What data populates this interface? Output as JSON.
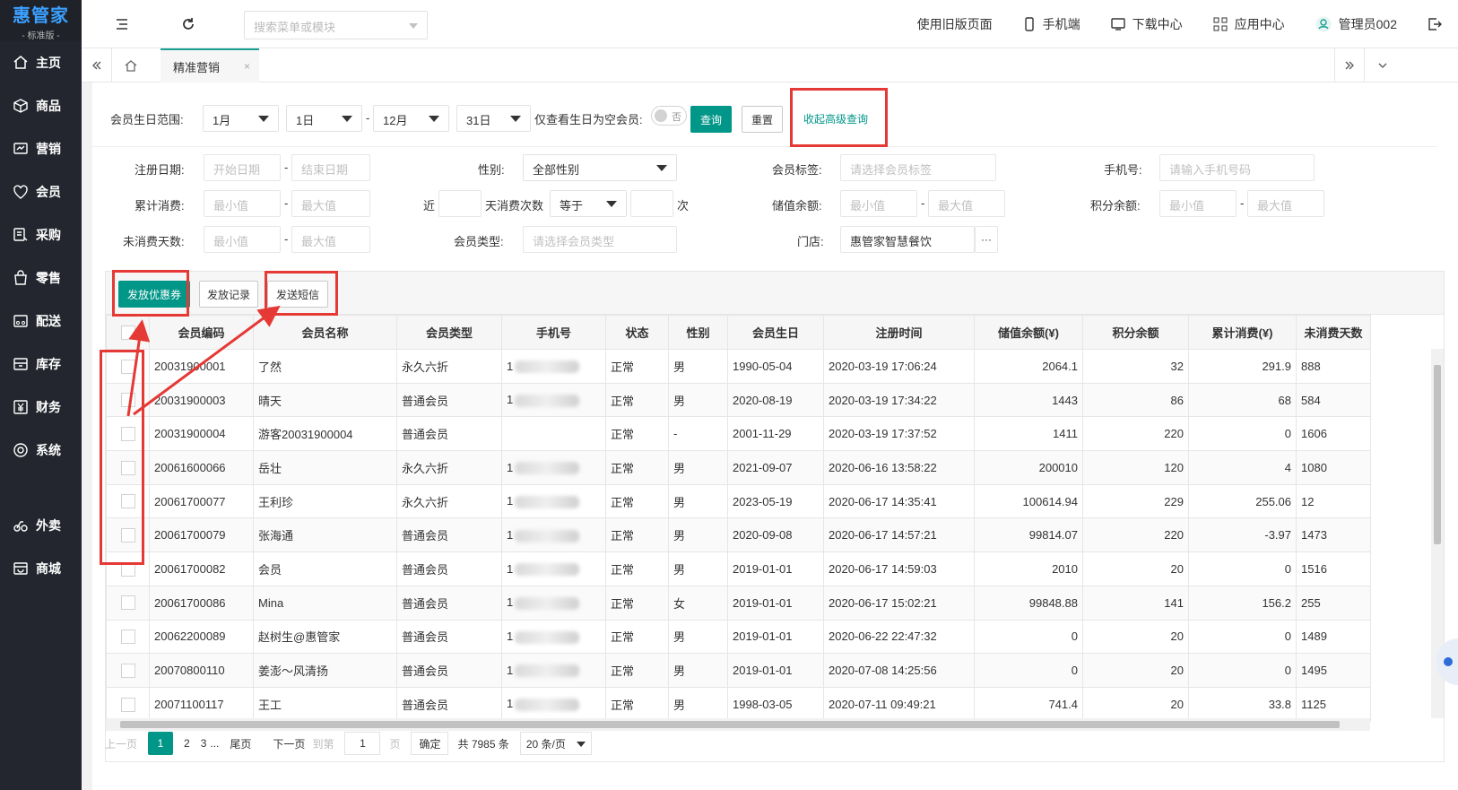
{
  "sidebar": {
    "logo": "惠管家",
    "logo_sub": "- 标准版 -",
    "items": [
      {
        "label": "主页",
        "icon": "home-icon"
      },
      {
        "label": "商品",
        "icon": "box-icon"
      },
      {
        "label": "营销",
        "icon": "marketing-icon"
      },
      {
        "label": "会员",
        "icon": "member-icon"
      },
      {
        "label": "采购",
        "icon": "purchase-icon"
      },
      {
        "label": "零售",
        "icon": "retail-icon"
      },
      {
        "label": "配送",
        "icon": "delivery-icon"
      },
      {
        "label": "库存",
        "icon": "inventory-icon"
      },
      {
        "label": "财务",
        "icon": "finance-icon"
      },
      {
        "label": "系统",
        "icon": "system-icon"
      },
      {
        "label": "外卖",
        "icon": "takeout-icon"
      },
      {
        "label": "商城",
        "icon": "mall-icon"
      }
    ]
  },
  "topbar": {
    "search_placeholder": "搜索菜单或模块",
    "old_page": "使用旧版页面",
    "mobile": "手机端",
    "download": "下载中心",
    "apps": "应用中心",
    "user": "管理员002"
  },
  "tabs": {
    "active": "精准营销",
    "close": "×"
  },
  "filters": {
    "birthday_label": "会员生日范围:",
    "from_month": "1月",
    "from_day": "1日",
    "to_month": "12月",
    "to_day": "31日",
    "dash": "-",
    "only_empty_birthday": "仅查看生日为空会员:",
    "toggle_text": "否",
    "query": "查询",
    "reset": "重置",
    "collapse_advanced": "收起高级查询",
    "reg_date_label": "注册日期:",
    "start_date": "开始日期",
    "end_date": "结束日期",
    "gender_label": "性别:",
    "gender_value": "全部性别",
    "tag_label": "会员标签:",
    "tag_placeholder": "请选择会员标签",
    "phone_label": "手机号:",
    "phone_placeholder": "请输入手机号码",
    "total_spend_label": "累计消费:",
    "min": "最小值",
    "max": "最大值",
    "recent_label": "近",
    "recent_days_label": "天消费次数",
    "equals": "等于",
    "times": "次",
    "balance_label": "储值余额:",
    "points_label": "积分余额:",
    "inactive_days_label": "未消费天数:",
    "member_type_label": "会员类型:",
    "member_type_placeholder": "请选择会员类型",
    "store_label": "门店:",
    "store_value": "惠管家智慧餐饮",
    "store_more": "···"
  },
  "actions": {
    "issue_coupon": "发放优惠券",
    "issue_record": "发放记录",
    "send_sms": "发送短信"
  },
  "table": {
    "columns": [
      "会员编码",
      "会员名称",
      "会员类型",
      "手机号",
      "状态",
      "性别",
      "会员生日",
      "注册时间",
      "储值余额(¥)",
      "积分余额",
      "累计消费(¥)",
      "未消费天数"
    ],
    "rows": [
      {
        "code": "20031900001",
        "name": "了然",
        "type": "永久六折",
        "phone": "1",
        "status": "正常",
        "gender": "男",
        "birthday": "1990-05-04",
        "reg": "2020-03-19 17:06:24",
        "balance": "2064.1",
        "points": "32",
        "spend": "291.9",
        "days": "888"
      },
      {
        "code": "20031900003",
        "name": "晴天",
        "type": "普通会员",
        "phone": "1",
        "status": "正常",
        "gender": "男",
        "birthday": "2020-08-19",
        "reg": "2020-03-19 17:34:22",
        "balance": "1443",
        "points": "86",
        "spend": "68",
        "days": "584"
      },
      {
        "code": "20031900004",
        "name": "游客20031900004",
        "type": "普通会员",
        "phone": "",
        "status": "正常",
        "gender": "-",
        "birthday": "2001-11-29",
        "reg": "2020-03-19 17:37:52",
        "balance": "1411",
        "points": "220",
        "spend": "0",
        "days": "1606"
      },
      {
        "code": "20061600066",
        "name": "岳壮",
        "type": "永久六折",
        "phone": "1",
        "status": "正常",
        "gender": "男",
        "birthday": "2021-09-07",
        "reg": "2020-06-16 13:58:22",
        "balance": "200010",
        "points": "120",
        "spend": "4",
        "days": "1080"
      },
      {
        "code": "20061700077",
        "name": "王利珍",
        "type": "永久六折",
        "phone": "1",
        "status": "正常",
        "gender": "男",
        "birthday": "2023-05-19",
        "reg": "2020-06-17 14:35:41",
        "balance": "100614.94",
        "points": "229",
        "spend": "255.06",
        "days": "12"
      },
      {
        "code": "20061700079",
        "name": "张海通",
        "type": "普通会员",
        "phone": "1",
        "status": "正常",
        "gender": "男",
        "birthday": "2020-09-08",
        "reg": "2020-06-17 14:57:21",
        "balance": "99814.07",
        "points": "220",
        "spend": "-3.97",
        "days": "1473"
      },
      {
        "code": "20061700082",
        "name": "会员",
        "type": "普通会员",
        "phone": "1",
        "status": "正常",
        "gender": "男",
        "birthday": "2019-01-01",
        "reg": "2020-06-17 14:59:03",
        "balance": "2010",
        "points": "20",
        "spend": "0",
        "days": "1516"
      },
      {
        "code": "20061700086",
        "name": "Mina",
        "type": "普通会员",
        "phone": "1",
        "status": "正常",
        "gender": "女",
        "birthday": "2019-01-01",
        "reg": "2020-06-17 15:02:21",
        "balance": "99848.88",
        "points": "141",
        "spend": "156.2",
        "days": "255"
      },
      {
        "code": "20062200089",
        "name": "赵树生@惠管家",
        "type": "普通会员",
        "phone": "1",
        "status": "正常",
        "gender": "男",
        "birthday": "2019-01-01",
        "reg": "2020-06-22 22:47:32",
        "balance": "0",
        "points": "20",
        "spend": "0",
        "days": "1489"
      },
      {
        "code": "20070800110",
        "name": "姜澎～风清扬",
        "type": "普通会员",
        "phone": "1",
        "status": "正常",
        "gender": "男",
        "birthday": "2019-01-01",
        "reg": "2020-07-08 14:25:56",
        "balance": "0",
        "points": "20",
        "spend": "0",
        "days": "1495"
      },
      {
        "code": "20071100117",
        "name": "王工",
        "type": "普通会员",
        "phone": "1",
        "status": "正常",
        "gender": "男",
        "birthday": "1998-03-05",
        "reg": "2020-07-11 09:49:21",
        "balance": "741.4",
        "points": "20",
        "spend": "33.8",
        "days": "1125"
      }
    ]
  },
  "pager": {
    "prev": "上一页",
    "pages": [
      "1",
      "2",
      "3"
    ],
    "ellipsis": "...",
    "last": "尾页",
    "next": "下一页",
    "goto": "到第",
    "goto_value": "1",
    "page_unit": "页",
    "confirm": "确定",
    "total": "共 7985 条",
    "per_page": "20 条/页"
  },
  "colors": {
    "accent": "#009688",
    "sidebar_bg": "#23262e",
    "highlight_red": "#e53935"
  }
}
